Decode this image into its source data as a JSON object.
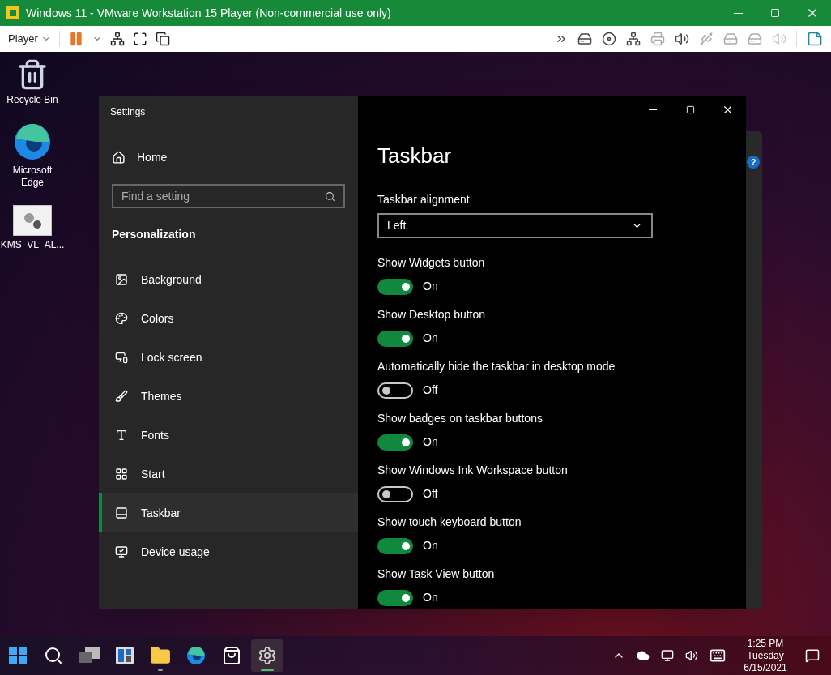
{
  "vm_window": {
    "title": "Windows 11 - VMware Workstation 15 Player (Non-commercial use only)",
    "menu": "Player"
  },
  "desktop_icons": [
    {
      "label": "Recycle Bin"
    },
    {
      "label": "Microsoft Edge"
    },
    {
      "label": "KMS_VL_AL..."
    }
  ],
  "settings": {
    "title": "Settings",
    "home": "Home",
    "search": {
      "placeholder": "Find a setting"
    },
    "section": "Personalization",
    "nav": [
      {
        "label": "Background",
        "selected": false
      },
      {
        "label": "Colors",
        "selected": false
      },
      {
        "label": "Lock screen",
        "selected": false
      },
      {
        "label": "Themes",
        "selected": false
      },
      {
        "label": "Fonts",
        "selected": false
      },
      {
        "label": "Start",
        "selected": false
      },
      {
        "label": "Taskbar",
        "selected": true
      },
      {
        "label": "Device usage",
        "selected": false
      }
    ],
    "page_title": "Taskbar",
    "alignment": {
      "label": "Taskbar alignment",
      "value": "Left"
    },
    "toggles": [
      {
        "label": "Show Widgets button",
        "on": true,
        "state": "On"
      },
      {
        "label": "Show Desktop button",
        "on": true,
        "state": "On"
      },
      {
        "label": "Automatically hide the taskbar in desktop mode",
        "on": false,
        "state": "Off"
      },
      {
        "label": "Show badges on taskbar buttons",
        "on": true,
        "state": "On"
      },
      {
        "label": "Show Windows Ink Workspace button",
        "on": false,
        "state": "Off"
      },
      {
        "label": "Show touch keyboard button",
        "on": true,
        "state": "On"
      },
      {
        "label": "Show Task View button",
        "on": true,
        "state": "On"
      }
    ]
  },
  "background_window": {
    "help": "?"
  },
  "taskbar": {
    "apps": [
      {
        "kind": "start",
        "running": false,
        "selected": false
      },
      {
        "kind": "search",
        "running": false,
        "selected": false
      },
      {
        "kind": "taskview",
        "running": false,
        "selected": false
      },
      {
        "kind": "widgets",
        "running": false,
        "selected": false
      },
      {
        "kind": "explorer",
        "running": true,
        "selected": false
      },
      {
        "kind": "edge",
        "running": false,
        "selected": false
      },
      {
        "kind": "store",
        "running": false,
        "selected": false
      },
      {
        "kind": "settings",
        "running": true,
        "selected": true
      }
    ],
    "time": "1:25 PM",
    "day": "Tuesday",
    "date": "6/15/2021"
  }
}
